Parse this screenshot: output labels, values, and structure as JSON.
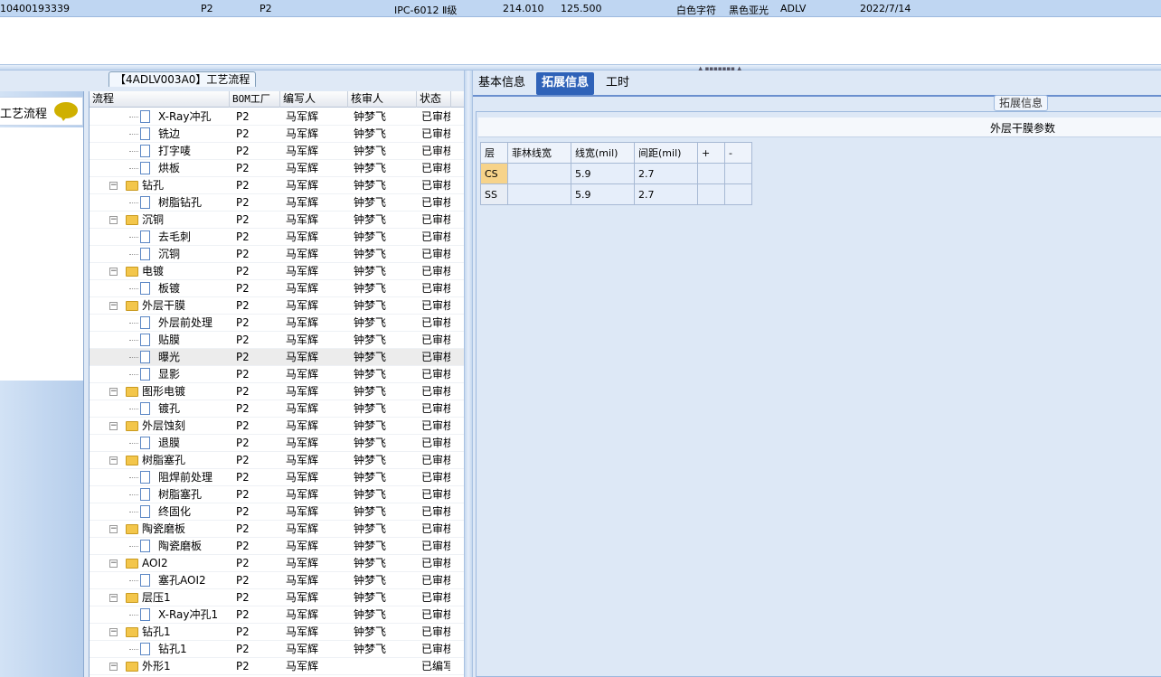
{
  "topbar": {
    "c1": "10400193339",
    "c2": "P2",
    "c3": "P2",
    "c4": "IPC-6012 Ⅱ级",
    "c5": "214.010",
    "c6": "125.500",
    "c7": "白色字符",
    "c8": "黑色亚光",
    "c9": "ADLV",
    "c10": "2022/7/14"
  },
  "left": {
    "title": "【4ADLV003A0】工艺流程",
    "nav_label": "工艺流程"
  },
  "tree": {
    "headers": {
      "flow": "流程",
      "bom": "BOM工厂",
      "author": "编写人",
      "reviewer": "核审人",
      "status": "状态"
    },
    "rows": [
      {
        "name": "X-Ray冲孔",
        "lvl": 2,
        "bom": "P2",
        "author": "马军辉",
        "reviewer": "钟梦飞",
        "status": "已审核"
      },
      {
        "name": "铣边",
        "lvl": 2,
        "bom": "P2",
        "author": "马军辉",
        "reviewer": "钟梦飞",
        "status": "已审核"
      },
      {
        "name": "打字唛",
        "lvl": 2,
        "bom": "P2",
        "author": "马军辉",
        "reviewer": "钟梦飞",
        "status": "已审核"
      },
      {
        "name": "烘板",
        "lvl": 2,
        "bom": "P2",
        "author": "马军辉",
        "reviewer": "钟梦飞",
        "status": "已审核"
      },
      {
        "name": "钻孔",
        "lvl": 1,
        "bom": "P2",
        "author": "马军辉",
        "reviewer": "钟梦飞",
        "status": "已审核"
      },
      {
        "name": "树脂钻孔",
        "lvl": 2,
        "bom": "P2",
        "author": "马军辉",
        "reviewer": "钟梦飞",
        "status": "已审核"
      },
      {
        "name": "沉铜",
        "lvl": 1,
        "bom": "P2",
        "author": "马军辉",
        "reviewer": "钟梦飞",
        "status": "已审核"
      },
      {
        "name": "去毛刺",
        "lvl": 2,
        "bom": "P2",
        "author": "马军辉",
        "reviewer": "钟梦飞",
        "status": "已审核"
      },
      {
        "name": "沉铜",
        "lvl": 2,
        "bom": "P2",
        "author": "马军辉",
        "reviewer": "钟梦飞",
        "status": "已审核"
      },
      {
        "name": "电镀",
        "lvl": 1,
        "bom": "P2",
        "author": "马军辉",
        "reviewer": "钟梦飞",
        "status": "已审核"
      },
      {
        "name": "板镀",
        "lvl": 2,
        "bom": "P2",
        "author": "马军辉",
        "reviewer": "钟梦飞",
        "status": "已审核"
      },
      {
        "name": "外层干膜",
        "lvl": 1,
        "bom": "P2",
        "author": "马军辉",
        "reviewer": "钟梦飞",
        "status": "已审核"
      },
      {
        "name": "外层前处理",
        "lvl": 2,
        "bom": "P2",
        "author": "马军辉",
        "reviewer": "钟梦飞",
        "status": "已审核"
      },
      {
        "name": "贴膜",
        "lvl": 2,
        "bom": "P2",
        "author": "马军辉",
        "reviewer": "钟梦飞",
        "status": "已审核"
      },
      {
        "name": "曝光",
        "lvl": 2,
        "bom": "P2",
        "author": "马军辉",
        "reviewer": "钟梦飞",
        "status": "已审核",
        "selected": true
      },
      {
        "name": "显影",
        "lvl": 2,
        "bom": "P2",
        "author": "马军辉",
        "reviewer": "钟梦飞",
        "status": "已审核"
      },
      {
        "name": "图形电镀",
        "lvl": 1,
        "bom": "P2",
        "author": "马军辉",
        "reviewer": "钟梦飞",
        "status": "已审核"
      },
      {
        "name": "镀孔",
        "lvl": 2,
        "bom": "P2",
        "author": "马军辉",
        "reviewer": "钟梦飞",
        "status": "已审核"
      },
      {
        "name": "外层蚀刻",
        "lvl": 1,
        "bom": "P2",
        "author": "马军辉",
        "reviewer": "钟梦飞",
        "status": "已审核"
      },
      {
        "name": "退膜",
        "lvl": 2,
        "bom": "P2",
        "author": "马军辉",
        "reviewer": "钟梦飞",
        "status": "已审核"
      },
      {
        "name": "树脂塞孔",
        "lvl": 1,
        "bom": "P2",
        "author": "马军辉",
        "reviewer": "钟梦飞",
        "status": "已审核"
      },
      {
        "name": "阻焊前处理",
        "lvl": 2,
        "bom": "P2",
        "author": "马军辉",
        "reviewer": "钟梦飞",
        "status": "已审核"
      },
      {
        "name": "树脂塞孔",
        "lvl": 2,
        "bom": "P2",
        "author": "马军辉",
        "reviewer": "钟梦飞",
        "status": "已审核"
      },
      {
        "name": "终固化",
        "lvl": 2,
        "bom": "P2",
        "author": "马军辉",
        "reviewer": "钟梦飞",
        "status": "已审核"
      },
      {
        "name": "陶瓷磨板",
        "lvl": 1,
        "bom": "P2",
        "author": "马军辉",
        "reviewer": "钟梦飞",
        "status": "已审核"
      },
      {
        "name": "陶瓷磨板",
        "lvl": 2,
        "bom": "P2",
        "author": "马军辉",
        "reviewer": "钟梦飞",
        "status": "已审核"
      },
      {
        "name": "AOI2",
        "lvl": 1,
        "bom": "P2",
        "author": "马军辉",
        "reviewer": "钟梦飞",
        "status": "已审核"
      },
      {
        "name": "塞孔AOI2",
        "lvl": 2,
        "bom": "P2",
        "author": "马军辉",
        "reviewer": "钟梦飞",
        "status": "已审核"
      },
      {
        "name": "层压1",
        "lvl": 1,
        "bom": "P2",
        "author": "马军辉",
        "reviewer": "钟梦飞",
        "status": "已审核"
      },
      {
        "name": "X-Ray冲孔1",
        "lvl": 2,
        "bom": "P2",
        "author": "马军辉",
        "reviewer": "钟梦飞",
        "status": "已审核"
      },
      {
        "name": "钻孔1",
        "lvl": 1,
        "bom": "P2",
        "author": "马军辉",
        "reviewer": "钟梦飞",
        "status": "已审核"
      },
      {
        "name": "钻孔1",
        "lvl": 2,
        "bom": "P2",
        "author": "马军辉",
        "reviewer": "钟梦飞",
        "status": "已审核"
      },
      {
        "name": "外形1",
        "lvl": 1,
        "bom": "P2",
        "author": "马军辉",
        "reviewer": "",
        "status": "已编写"
      }
    ]
  },
  "tabs": [
    {
      "label": "基本信息",
      "active": false
    },
    {
      "label": "拓展信息",
      "active": true
    },
    {
      "label": "工时",
      "active": false
    }
  ],
  "panel": {
    "subtitle": "拓展信息",
    "heading": "外层干膜参数"
  },
  "grid": {
    "headers": [
      "层",
      "菲林线宽",
      "线宽(mil)",
      "间距(mil)",
      "+",
      "-"
    ],
    "rows": [
      [
        "CS",
        "",
        "5.9",
        "2.7",
        "",
        ""
      ],
      [
        "SS",
        "",
        "5.9",
        "2.7",
        "",
        ""
      ]
    ]
  }
}
